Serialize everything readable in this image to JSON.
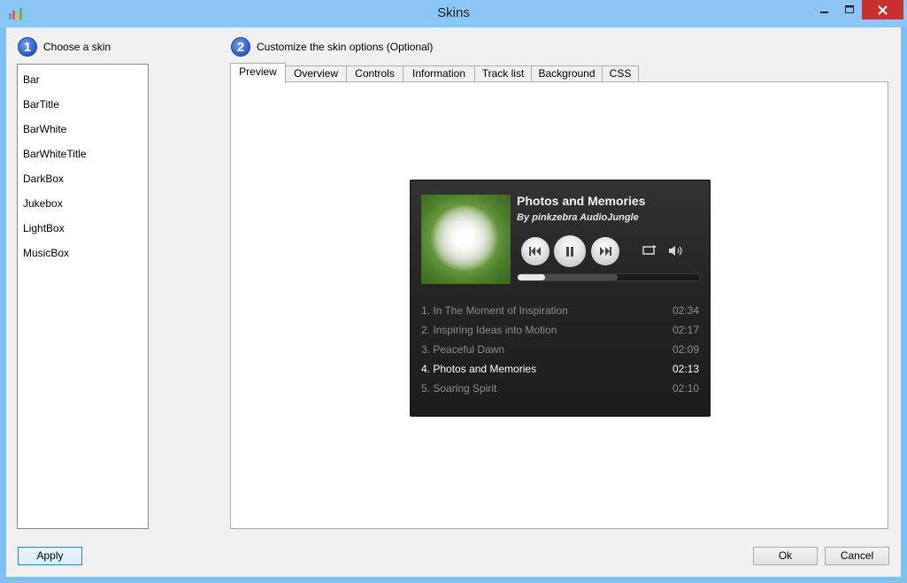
{
  "window": {
    "title": "Skins"
  },
  "colors": {
    "titlebar": "#8cc6f5",
    "close_button": "#c7302b",
    "step_badge": "#2c57c7"
  },
  "steps": [
    {
      "number": "1",
      "label": "Choose a skin"
    },
    {
      "number": "2",
      "label": "Customize the skin options (Optional)"
    }
  ],
  "skins": [
    "Bar",
    "BarTitle",
    "BarWhite",
    "BarWhiteTitle",
    "DarkBox",
    "Jukebox",
    "LightBox",
    "MusicBox"
  ],
  "tabs": [
    "Preview",
    "Overview",
    "Controls",
    "Information",
    "Track list",
    "Background",
    "CSS"
  ],
  "active_tab": "Preview",
  "player": {
    "now_playing_title": "Photos and Memories",
    "artist": "By pinkzebra AudioJungle",
    "progress_played": 0.15,
    "progress_buffered": 0.55,
    "tracks": [
      {
        "name": "1. In The Moment of Inspiration",
        "duration": "02:34"
      },
      {
        "name": "2. Inspiring Ideas into Motion",
        "duration": "02:17"
      },
      {
        "name": "3. Peaceful Dawn",
        "duration": "02:09"
      },
      {
        "name": "4. Photos and Memories",
        "duration": "02:13"
      },
      {
        "name": "5. Soaring Spirit",
        "duration": "02:10"
      }
    ],
    "current_track": 3,
    "icons": [
      "cover-art",
      "previous-icon",
      "pause-icon",
      "next-icon",
      "repeat-icon",
      "volume-icon"
    ]
  },
  "buttons": {
    "apply": "Apply",
    "ok": "Ok",
    "cancel": "Cancel"
  }
}
